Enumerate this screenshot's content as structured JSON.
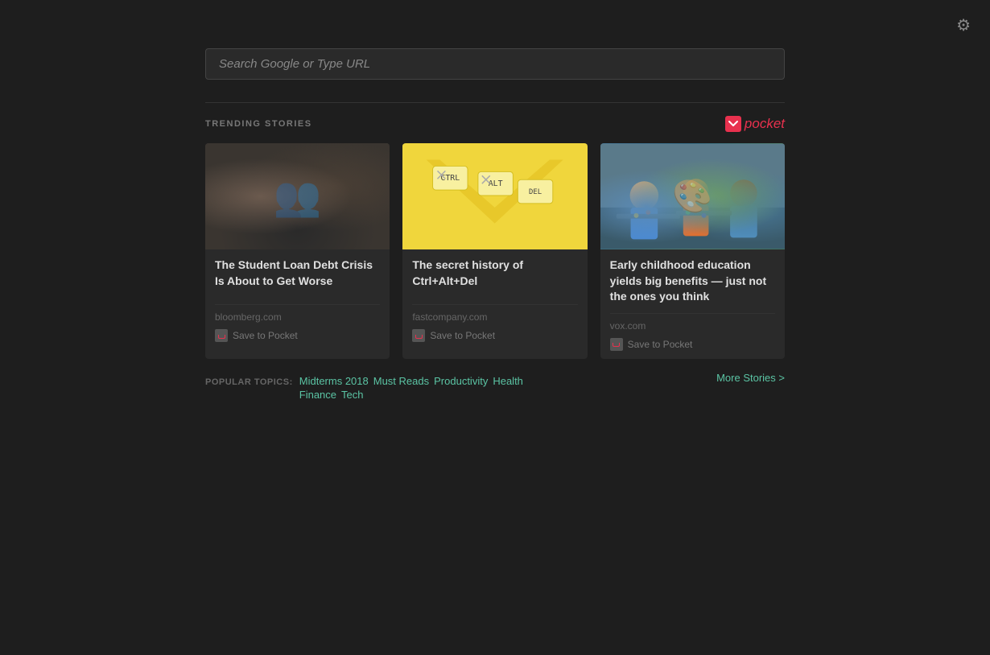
{
  "settings": {
    "icon": "⚙",
    "aria": "Settings"
  },
  "search": {
    "placeholder": "Search Google or Type URL"
  },
  "trending": {
    "label": "TRENDING STORIES",
    "pocket_brand": "pocket"
  },
  "cards": [
    {
      "id": "card-1",
      "title": "The Student Loan Debt Crisis Is About to Get Worse",
      "source": "bloomberg.com",
      "save_label": "Save to Pocket",
      "image_type": "students-crowd"
    },
    {
      "id": "card-2",
      "title": "The secret history of Ctrl+Alt+Del",
      "source": "fastcompany.com",
      "save_label": "Save to Pocket",
      "image_type": "keyboard-illustration"
    },
    {
      "id": "card-3",
      "title": "Early childhood education yields big benefits — just not the ones you think",
      "source": "vox.com",
      "save_label": "Save to Pocket",
      "image_type": "children-classroom"
    }
  ],
  "popular_topics": {
    "label": "POPULAR TOPICS:",
    "topics_row1": [
      {
        "label": "Midterms 2018"
      },
      {
        "label": "Must Reads"
      },
      {
        "label": "Productivity"
      },
      {
        "label": "Health"
      }
    ],
    "topics_row2": [
      {
        "label": "Finance"
      },
      {
        "label": "Tech"
      }
    ],
    "more_stories": "More Stories >"
  }
}
